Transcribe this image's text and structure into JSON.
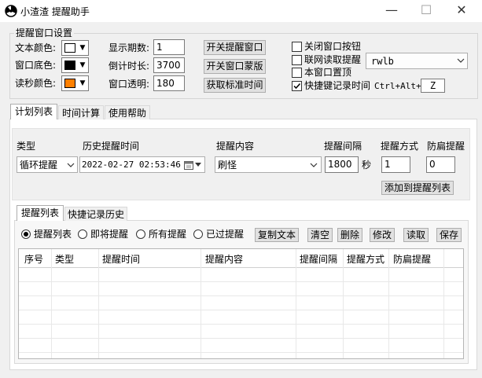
{
  "window": {
    "title": "小渣渣 提醒助手",
    "minimize": "—",
    "maximize": "☐",
    "close": "✕"
  },
  "settings": {
    "group_label": "提醒窗口设置",
    "text_color_label": "文本颜色:",
    "text_color": "#ffffff",
    "window_bg_label": "窗口底色:",
    "window_bg": "#000000",
    "countdown_color_label": "读秒颜色:",
    "countdown_color": "#ff8000",
    "display_count_label": "显示期数:",
    "display_count": "1",
    "countdown_duration_label": "倒计时长:",
    "countdown_duration": "3700",
    "window_opacity_label": "窗口透明:",
    "window_opacity": "180",
    "toggle_window_button": "开关提醒窗口",
    "toggle_mask_button": "开关窗口蒙版",
    "get_time_button": "获取标准时间",
    "close_window_button_check": "关闭窗口按钮",
    "online_read_check": "联网读取提醒",
    "online_source": "rwlb",
    "topmost_check": "本窗口置顶",
    "hotkey_record_check": "快捷键记录时间",
    "hotkey_prefix": "Ctrl+Alt+",
    "hotkey_key": "Z"
  },
  "main_tabs": [
    "计划列表",
    "时间计算",
    "使用帮助"
  ],
  "plan": {
    "type_header": "类型",
    "type_value": "循环提醒",
    "history_time_header": "历史提醒时间",
    "history_time_value": "2022-02-27 02:53:46",
    "content_header": "提醒内容",
    "content_value": "刷怪",
    "interval_header": "提醒间隔",
    "interval_value": "1800",
    "interval_unit": "秒",
    "mode_header": "提醒方式",
    "mode_value": "1",
    "anti_flicker_header": "防扁提醒",
    "anti_flicker_value": "0",
    "add_button": "添加到提醒列表"
  },
  "sub_tabs": [
    "提醒列表",
    "快捷记录历史"
  ],
  "filters": [
    "提醒列表",
    "即将提醒",
    "所有提醒",
    "已过提醒"
  ],
  "actions": [
    "复制文本",
    "清空",
    "删除",
    "修改",
    "读取",
    "保存"
  ],
  "table": {
    "columns": [
      "序号",
      "类型",
      "提醒时间",
      "提醒内容",
      "提醒间隔",
      "提醒方式",
      "防扁提醒"
    ],
    "rows": []
  }
}
